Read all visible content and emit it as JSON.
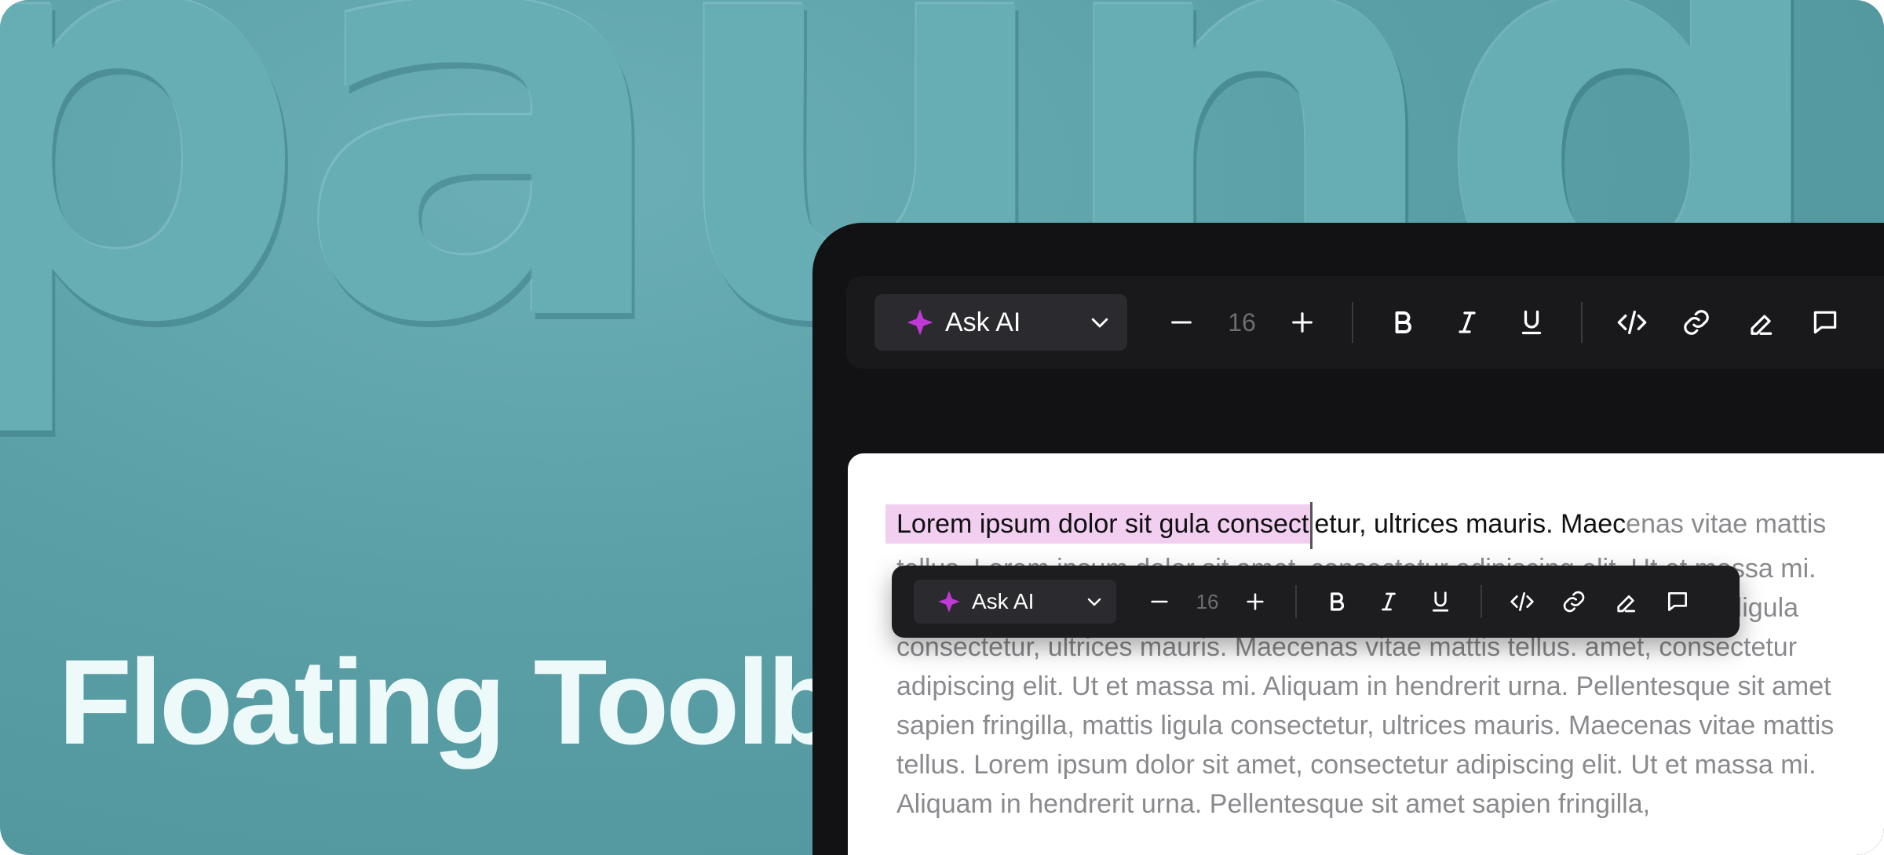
{
  "background": {
    "word": "paund",
    "headline": "Floating Toolbar",
    "color": "#5aa0a7"
  },
  "toolbar_main": {
    "ask_ai_label": "Ask AI",
    "font_size": "16",
    "accent": "#c039d6"
  },
  "toolbar_floating": {
    "ask_ai_label": "Ask AI",
    "font_size": "16"
  },
  "document": {
    "selected_text": "Lorem ipsum dolor sit gula consect",
    "first_line_rest": "etur, ultrices mauris. Maec",
    "first_line_faded": "enas",
    "body": "vitae mattis tellus. Lorem ipsum dolor sit amet, consectetur adipiscing elit. Ut et massa mi. Aliquam in hendrerit urna. Pellentesque sit amet sapien fringilla, mattis ligula consectetur, ultrices mauris. Maecenas vitae mattis tellus. amet, consectetur adipiscing elit. Ut et massa mi. Aliquam in hendrerit urna. Pellentesque sit amet sapien fringilla, mattis ligula consectetur, ultrices mauris. Maecenas vitae mattis tellus. Lorem ipsum dolor sit amet, consectetur adipiscing elit. Ut et massa mi. Aliquam in hendrerit urna. Pellentesque sit amet sapien fringilla,",
    "highlight_color": "#f2cef1"
  },
  "icons": [
    "sparkle-icon",
    "chevron-down-icon",
    "minus-icon",
    "plus-icon",
    "bold-icon",
    "italic-icon",
    "underline-icon",
    "code-icon",
    "link-icon",
    "highlighter-icon",
    "comment-icon"
  ]
}
